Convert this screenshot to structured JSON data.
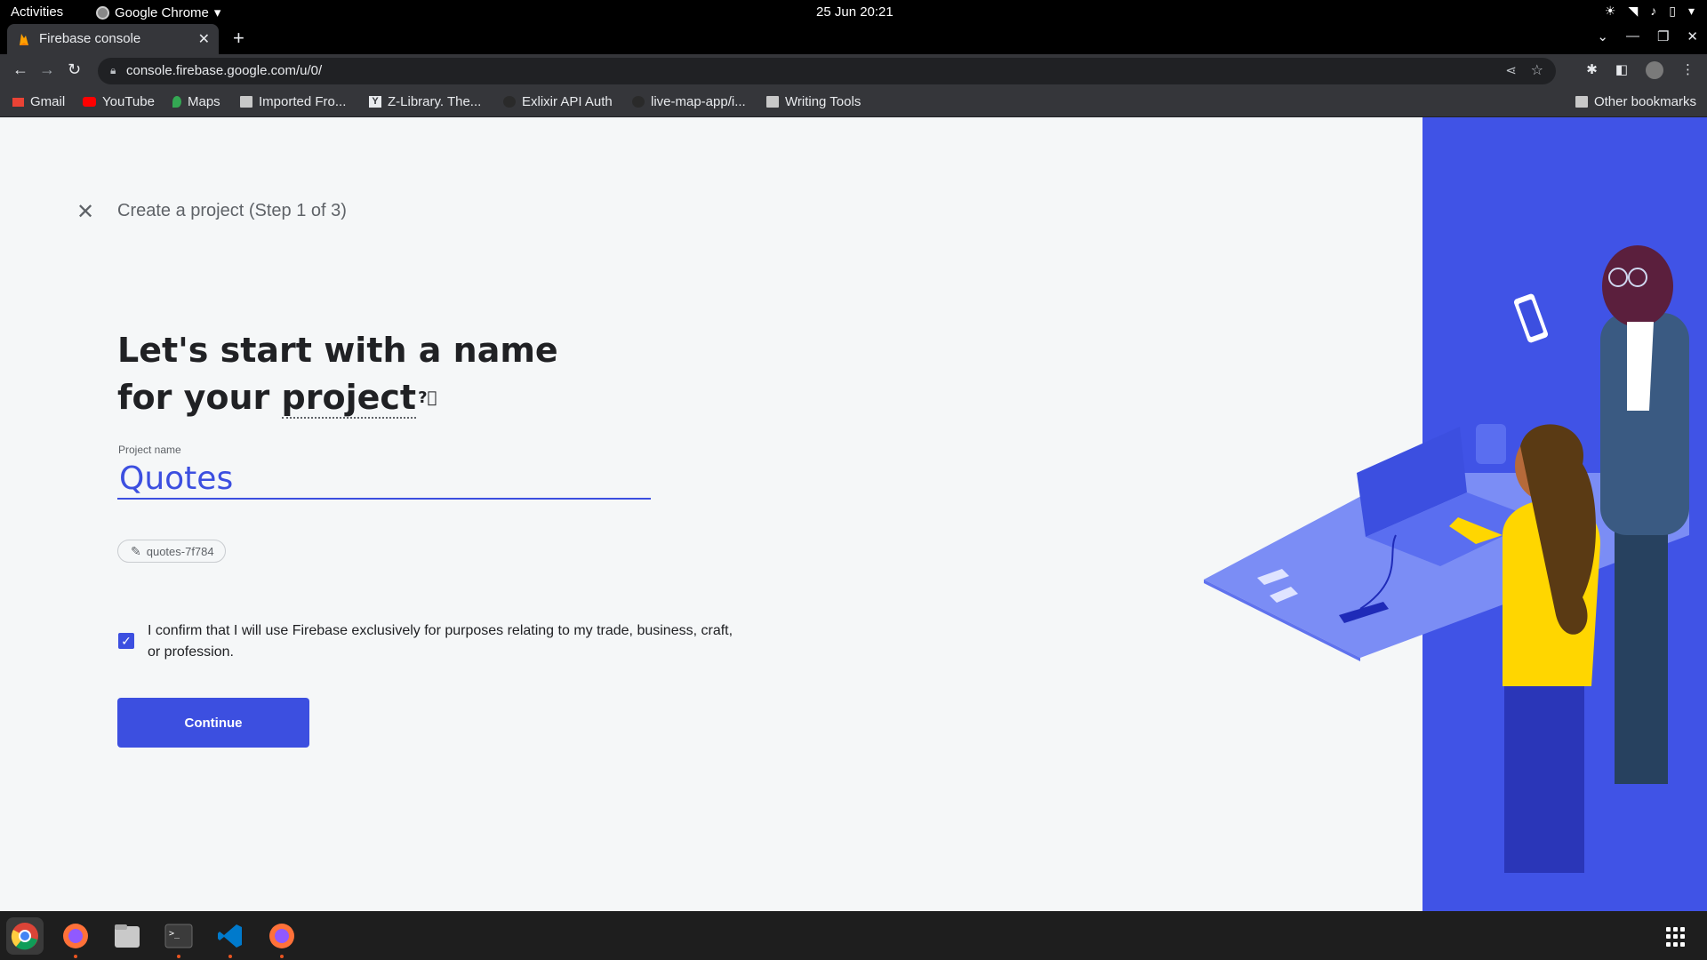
{
  "system": {
    "activities": "Activities",
    "app_name": "Google Chrome",
    "clock": "25 Jun  20:21"
  },
  "browser": {
    "tab_title": "Firebase console",
    "url": "console.firebase.google.com/u/0/",
    "bookmarks": [
      "Gmail",
      "YouTube",
      "Maps",
      "Imported Fro...",
      "Z-Library. The...",
      "Exlixir API Auth",
      "live-map-app/i...",
      "Writing Tools"
    ],
    "other_bookmarks": "Other bookmarks"
  },
  "page": {
    "step_title": "Create a project (Step 1 of 3)",
    "headline_start": "Let's start with a name for your ",
    "headline_underlined": "project",
    "field_label": "Project name",
    "project_name": "Quotes",
    "project_id": "quotes-7f784",
    "confirm_text": "I confirm that I will use Firebase exclusively for purposes relating to my trade, business, craft, or profession.",
    "confirm_checked": true,
    "continue_label": "Continue"
  },
  "colors": {
    "accent": "#3c4fe0",
    "panel": "#4053e6"
  },
  "icons": {
    "close": "close-icon",
    "help": "help-circle-icon",
    "edit": "pencil-icon",
    "check": "check-icon"
  }
}
